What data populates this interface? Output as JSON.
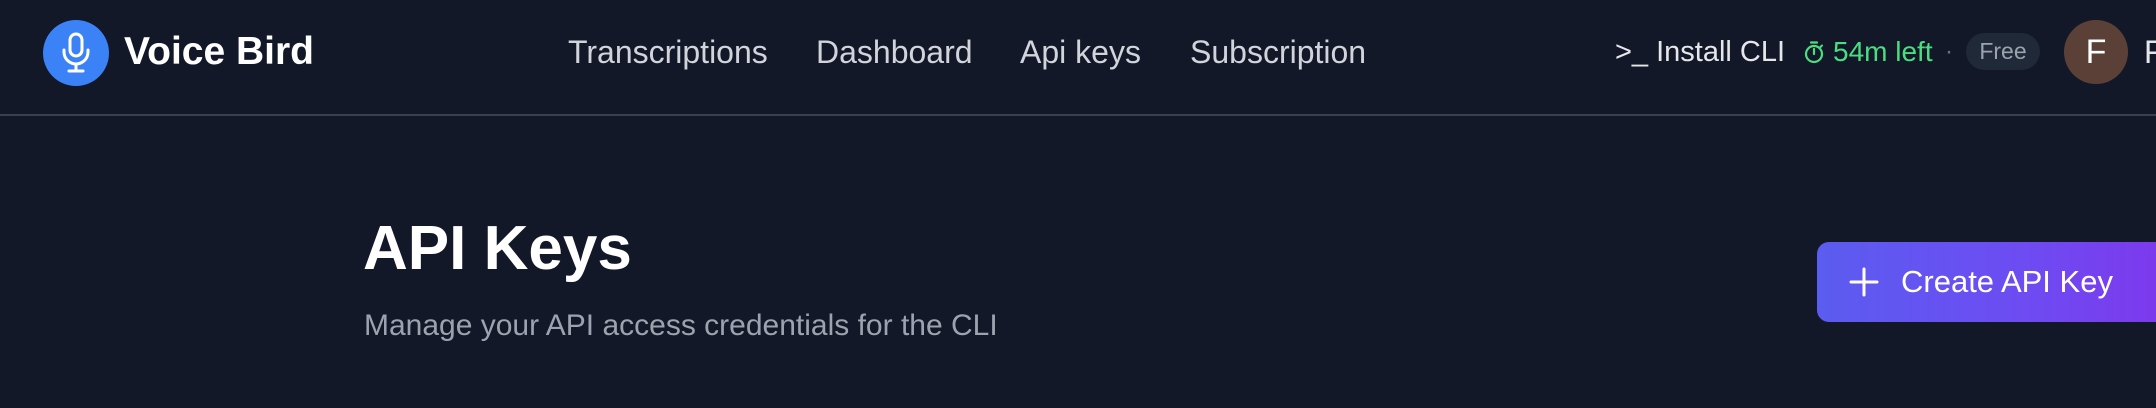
{
  "header": {
    "brand": "Voice Bird",
    "logo_icon": "microphone-icon",
    "nav": [
      {
        "label": "Transcriptions"
      },
      {
        "label": "Dashboard"
      },
      {
        "label": "Api keys"
      },
      {
        "label": "Subscription"
      }
    ],
    "install_cli": ">_ Install CLI",
    "timer": {
      "icon": "stopwatch-icon",
      "text": "54m left"
    },
    "separator": "·",
    "plan": "Free",
    "user": {
      "initial": "F",
      "name_visible": "F"
    }
  },
  "main": {
    "title": "API Keys",
    "subtitle": "Manage your API access credentials for the CLI",
    "create_button": {
      "icon": "plus-icon",
      "label": "Create API Key"
    }
  },
  "colors": {
    "background": "#131828",
    "logo": "#3b82f6",
    "timer": "#4ade80",
    "avatar": "#5b4037",
    "button_start": "#5b5cf0",
    "button_end": "#7c3aed"
  }
}
